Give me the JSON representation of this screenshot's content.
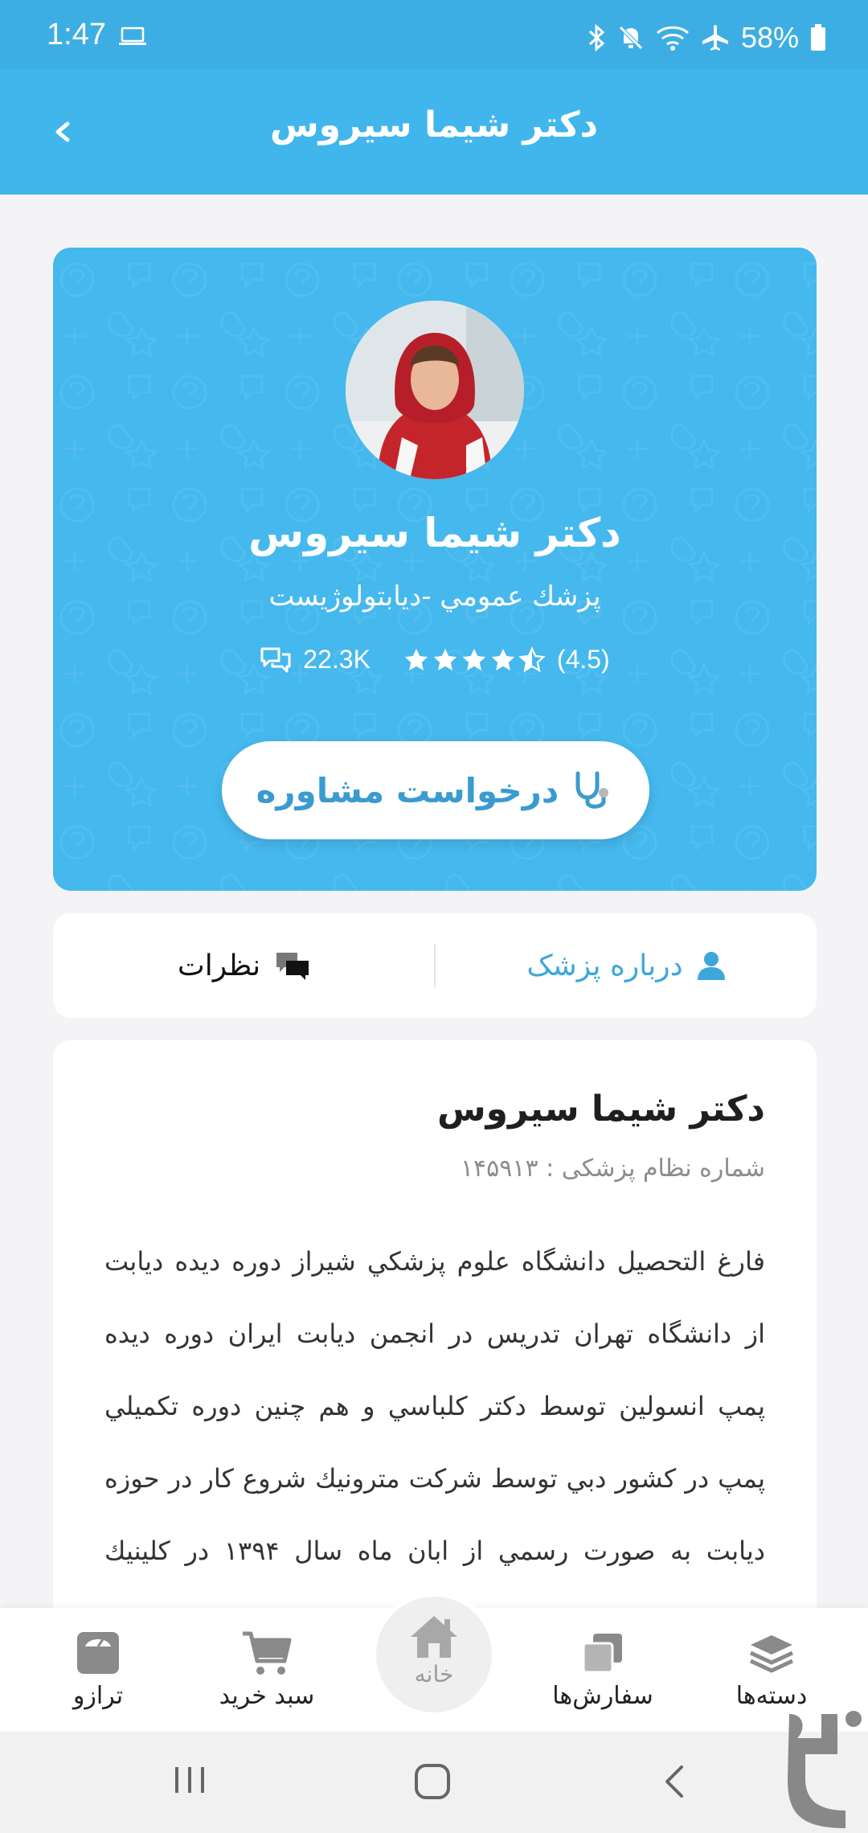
{
  "status_bar": {
    "time": "1:47",
    "battery": "58%"
  },
  "app_bar": {
    "title": "دکتر شیما سیروس"
  },
  "profile": {
    "name": "دکتر شیما سیروس",
    "specialty": "پزشك عمومي -ديابتولوژيست",
    "consultations": "22.3K",
    "rating": "(4.5)",
    "rating_value": 4.5,
    "consult_button": "درخواست مشاوره"
  },
  "tabs": {
    "about": "درباره پزشک",
    "comments": "نظرات"
  },
  "about": {
    "name": "دکتر شیما سیروس",
    "license": "شماره نظام پزشکی : ۱۴۵۹۱۳",
    "bio": "فارغ التحصيل دانشگاه علوم پزشكي شيراز دوره ديده ديابت از دانشگاه تهران تدريس در انجمن ديابت ايران دوره ديده پمپ انسولين توسط دكتر كلباسي و هم چنين دوره تكميلي پمپ در كشور دبي توسط شركت مترونيك شروع كار در حوزه ديابت به صورت رسمي از ابان ماه سال ۱۳۹۴ در كلينيك تخصصي"
  },
  "bottom_nav": {
    "categories": "دسته‌ها",
    "orders": "سفارش‌ها",
    "home": "خانه",
    "cart": "سبد خرید",
    "scale": "ترازو"
  },
  "colors": {
    "primary": "#41b6ec",
    "accent": "#3a9bd0"
  }
}
